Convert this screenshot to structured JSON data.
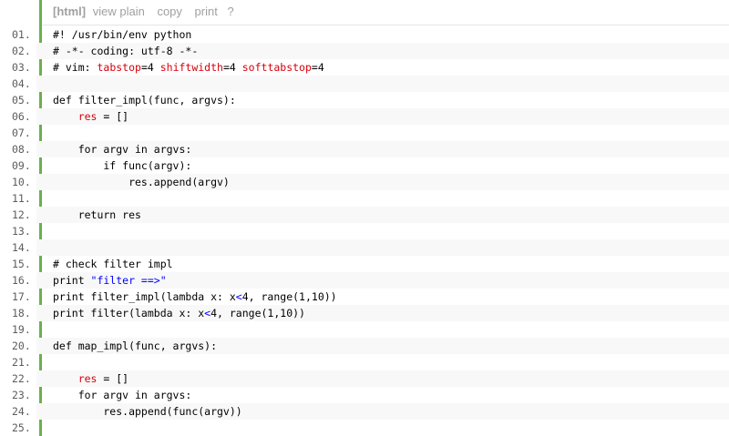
{
  "toolbar": {
    "html_label": "[html]",
    "view_plain_label": "view plain",
    "copy_label": "copy",
    "print_label": "print",
    "help_label": "?"
  },
  "colors": {
    "gutter_accent": "#6ab04c",
    "keyword_red": "#d8000c",
    "string_blue": "#0000ff",
    "line_number": "#5c5c5c"
  },
  "lines": [
    {
      "num": "01.",
      "parts": [
        {
          "t": "#! /usr/bin/env python",
          "c": "cm"
        }
      ]
    },
    {
      "num": "02.",
      "parts": [
        {
          "t": "# -*- coding: utf-8 -*-",
          "c": "cm"
        }
      ]
    },
    {
      "num": "03.",
      "parts": [
        {
          "t": "# vim: ",
          "c": "cm"
        },
        {
          "t": "tabstop",
          "c": "red"
        },
        {
          "t": "=4 ",
          "c": "cm"
        },
        {
          "t": "shiftwidth",
          "c": "red"
        },
        {
          "t": "=4 ",
          "c": "cm"
        },
        {
          "t": "softtabstop",
          "c": "red"
        },
        {
          "t": "=4",
          "c": "cm"
        }
      ]
    },
    {
      "num": "04.",
      "parts": []
    },
    {
      "num": "05.",
      "parts": [
        {
          "t": "def filter_impl(func, argvs):",
          "c": "kw"
        }
      ]
    },
    {
      "num": "06.",
      "parts": [
        {
          "t": "    ",
          "c": "kw"
        },
        {
          "t": "res",
          "c": "red"
        },
        {
          "t": " = []",
          "c": "kw"
        }
      ]
    },
    {
      "num": "07.",
      "parts": []
    },
    {
      "num": "08.",
      "parts": [
        {
          "t": "    for argv in argvs:",
          "c": "kw"
        }
      ]
    },
    {
      "num": "09.",
      "parts": [
        {
          "t": "        if func(argv):",
          "c": "kw"
        }
      ]
    },
    {
      "num": "10.",
      "parts": [
        {
          "t": "            res.append(argv)",
          "c": "kw"
        }
      ]
    },
    {
      "num": "11.",
      "parts": []
    },
    {
      "num": "12.",
      "parts": [
        {
          "t": "    return res",
          "c": "kw"
        }
      ]
    },
    {
      "num": "13.",
      "parts": []
    },
    {
      "num": "14.",
      "parts": []
    },
    {
      "num": "15.",
      "parts": [
        {
          "t": "# check filter impl",
          "c": "cm"
        }
      ]
    },
    {
      "num": "16.",
      "parts": [
        {
          "t": "print ",
          "c": "kw"
        },
        {
          "t": "\"filter ==>\"",
          "c": "str"
        }
      ]
    },
    {
      "num": "17.",
      "parts": [
        {
          "t": "print filter_impl(lambda x: x",
          "c": "kw"
        },
        {
          "t": "<",
          "c": "blue"
        },
        {
          "t": "4, range(1,10))",
          "c": "kw"
        }
      ]
    },
    {
      "num": "18.",
      "parts": [
        {
          "t": "print filter(lambda x: x",
          "c": "kw"
        },
        {
          "t": "<",
          "c": "blue"
        },
        {
          "t": "4, range(1,10))",
          "c": "kw"
        }
      ]
    },
    {
      "num": "19.",
      "parts": []
    },
    {
      "num": "20.",
      "parts": [
        {
          "t": "def map_impl(func, argvs):",
          "c": "kw"
        }
      ]
    },
    {
      "num": "21.",
      "parts": []
    },
    {
      "num": "22.",
      "parts": [
        {
          "t": "    ",
          "c": "kw"
        },
        {
          "t": "res",
          "c": "red"
        },
        {
          "t": " = []",
          "c": "kw"
        }
      ]
    },
    {
      "num": "23.",
      "parts": [
        {
          "t": "    for argv in argvs:",
          "c": "kw"
        }
      ]
    },
    {
      "num": "24.",
      "parts": [
        {
          "t": "        res.append(func(argv))",
          "c": "kw"
        }
      ]
    },
    {
      "num": "25.",
      "parts": []
    }
  ]
}
